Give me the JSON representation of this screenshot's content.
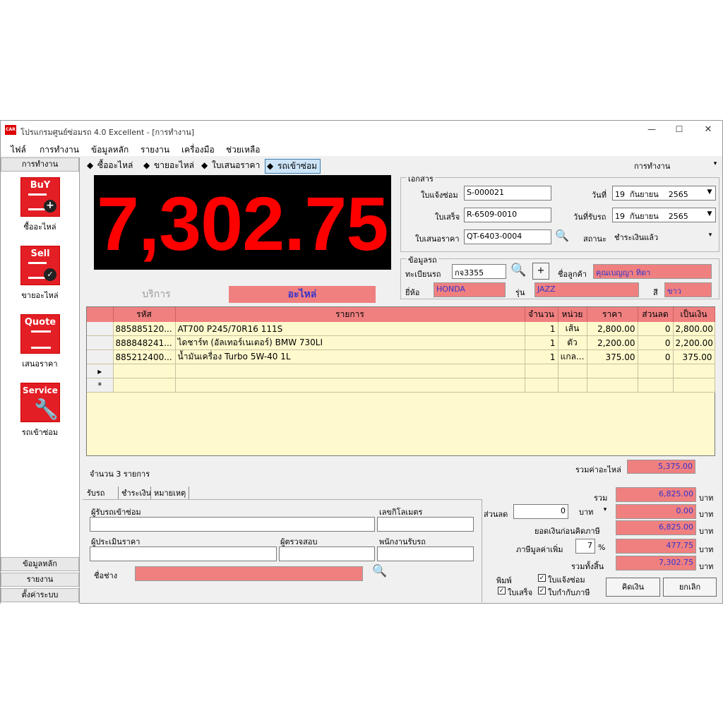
{
  "window": {
    "title": "โปรแกรมศูนย์ซ่อมรถ 4.0 Excellent - [การทำงาน]",
    "app_icon": "CAR",
    "controls": [
      "—",
      "☐",
      "✕"
    ]
  },
  "menu": [
    "ไฟล์",
    "การทำงาน",
    "ข้อมูลหลัก",
    "รายงาน",
    "เครื่องมือ",
    "ช่วยเหลือ"
  ],
  "sidebar": {
    "header": "การทำงาน",
    "items": [
      {
        "icon_text": "BuY",
        "label": "ซื้ออะไหล่",
        "icon": "buy-icon"
      },
      {
        "icon_text": "Sell",
        "label": "ขายอะไหล่",
        "icon": "sell-icon"
      },
      {
        "icon_text": "Quote",
        "label": "เสนอราคา",
        "icon": "quote-icon"
      },
      {
        "icon_text": "Service",
        "label": "รถเข้าซ่อม",
        "icon": "wrench-icon"
      }
    ],
    "footer": [
      "ข้อมูลหลัก",
      "รายงาน",
      "ตั้งค่าระบบ"
    ]
  },
  "toptabs": [
    "ซื้ออะไหล่",
    "ขายอะไหล่",
    "ใบเสนอราคา",
    "รถเข้าซ่อม"
  ],
  "mode_select": "การทำงาน",
  "big_total": "7,302.75",
  "document": {
    "title": "เอกสาร",
    "repair_label": "ใบแจ้งซ่อม",
    "repair_no": "S-000021",
    "receipt_label": "ใบเสร็จ",
    "receipt_no": "R-6509-0010",
    "quote_label": "ใบเสนอราคา",
    "quote_no": "QT-6403-0004",
    "date_label": "วันที่",
    "date_day": "19",
    "date_month": "กันยายน",
    "date_year": "2565",
    "pickup_label": "วันที่รับรถ",
    "pickup_day": "19",
    "pickup_month": "กันยายน",
    "pickup_year": "2565",
    "status_label": "สถานะ",
    "status": "ชำระเงินแล้ว"
  },
  "vehicle": {
    "title": "ข้อมูลรถ",
    "plate_label": "ทะเบียนรถ",
    "plate": "กจ3355",
    "customer_label": "ชื่อลูกค้า",
    "customer": "คุณเบญญา ทิดา",
    "brand_label": "ยี่ห้อ",
    "brand": "HONDA",
    "model_label": "รุ่น",
    "model": "JAZZ",
    "color_label": "สี",
    "color": "ขาว",
    "add_button": "+"
  },
  "subtabs": {
    "service": "บริการ",
    "parts": "อะไหล่"
  },
  "table": {
    "headers": [
      "รหัส",
      "รายการ",
      "จำนวน",
      "หน่วย",
      "ราคา",
      "ส่วนลด",
      "เป็นเงิน"
    ],
    "rows": [
      [
        "885885120...",
        "AT700 P245/70R16 111S",
        "1",
        "เส้น",
        "2,800.00",
        "0",
        "2,800.00"
      ],
      [
        "888848241...",
        "ไดชาร์ท (อัลเทอร์เนเตอร์) BMW 730LI",
        "1",
        "ตัว",
        "2,200.00",
        "0",
        "2,200.00"
      ],
      [
        "885212400...",
        "น้ำมันเครื่อง Turbo 5W-40 1L",
        "1",
        "แกล...",
        "375.00",
        "0",
        "375.00"
      ]
    ],
    "current_marker": "▸",
    "new_marker": "*"
  },
  "count_text": "จำนวน 3 รายการ",
  "parts_total_label": "รวมค่าอะไหล่",
  "parts_total": "5,375.00",
  "bottom_tabs": [
    "รับรถ",
    "ชำระเงิน",
    "หมายเหตุ"
  ],
  "receive": {
    "receiver_label": "ผู้รับรถเข้าซ่อม",
    "mileage_label": "เลขกิโลเมตร",
    "estimator_label": "ผู้ประเมินราคา",
    "inspector_label": "ผู้ตรวจสอบ",
    "staff_label": "พนักงานรับรถ",
    "mechanic_label": "ชื่อช่าง"
  },
  "summary": {
    "sum_label": "รวม",
    "sum": "6,825.00",
    "discount_label": "ส่วนลด",
    "discount_value": "0",
    "discount_unit": "บาท",
    "discount_amount": "0.00",
    "pretax_label": "ยอดเงินก่อนคิดภาษี",
    "pretax": "6,825.00",
    "vat_label": "ภาษีมูลค่าเพิ่ม",
    "vat_rate": "7",
    "vat_percent": "%",
    "vat": "477.75",
    "grand_label": "รวมทั้งสิ้น",
    "grand": "7,302.75",
    "currency": "บาท"
  },
  "print": {
    "label": "พิมพ์",
    "repair_slip": "ใบแจ้งซ่อม",
    "receipt": "ใบเสร็จ",
    "tax_invoice": "ใบกำกับภาษี"
  },
  "buttons": {
    "calculate": "คิดเงิน",
    "cancel": "ยกเลิก"
  },
  "colors": {
    "accent_pink": "#f08080",
    "display_red": "#ff0000",
    "grid_bg": "#fffacd",
    "icon_red": "#e31e24"
  }
}
